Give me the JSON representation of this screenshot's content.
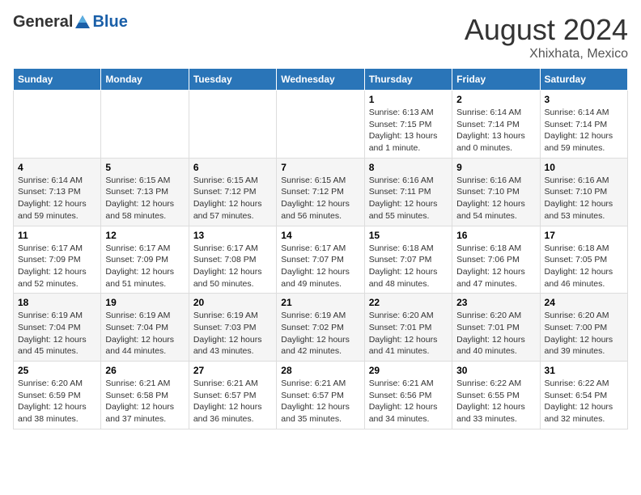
{
  "header": {
    "logo_general": "General",
    "logo_blue": "Blue",
    "month_year": "August 2024",
    "location": "Xhixhata, Mexico"
  },
  "days_of_week": [
    "Sunday",
    "Monday",
    "Tuesday",
    "Wednesday",
    "Thursday",
    "Friday",
    "Saturday"
  ],
  "weeks": [
    [
      {
        "day": "",
        "sunrise": "",
        "sunset": "",
        "daylight": ""
      },
      {
        "day": "",
        "sunrise": "",
        "sunset": "",
        "daylight": ""
      },
      {
        "day": "",
        "sunrise": "",
        "sunset": "",
        "daylight": ""
      },
      {
        "day": "",
        "sunrise": "",
        "sunset": "",
        "daylight": ""
      },
      {
        "day": "1",
        "sunrise": "Sunrise: 6:13 AM",
        "sunset": "Sunset: 7:15 PM",
        "daylight": "Daylight: 13 hours and 1 minute."
      },
      {
        "day": "2",
        "sunrise": "Sunrise: 6:14 AM",
        "sunset": "Sunset: 7:14 PM",
        "daylight": "Daylight: 13 hours and 0 minutes."
      },
      {
        "day": "3",
        "sunrise": "Sunrise: 6:14 AM",
        "sunset": "Sunset: 7:14 PM",
        "daylight": "Daylight: 12 hours and 59 minutes."
      }
    ],
    [
      {
        "day": "4",
        "sunrise": "Sunrise: 6:14 AM",
        "sunset": "Sunset: 7:13 PM",
        "daylight": "Daylight: 12 hours and 59 minutes."
      },
      {
        "day": "5",
        "sunrise": "Sunrise: 6:15 AM",
        "sunset": "Sunset: 7:13 PM",
        "daylight": "Daylight: 12 hours and 58 minutes."
      },
      {
        "day": "6",
        "sunrise": "Sunrise: 6:15 AM",
        "sunset": "Sunset: 7:12 PM",
        "daylight": "Daylight: 12 hours and 57 minutes."
      },
      {
        "day": "7",
        "sunrise": "Sunrise: 6:15 AM",
        "sunset": "Sunset: 7:12 PM",
        "daylight": "Daylight: 12 hours and 56 minutes."
      },
      {
        "day": "8",
        "sunrise": "Sunrise: 6:16 AM",
        "sunset": "Sunset: 7:11 PM",
        "daylight": "Daylight: 12 hours and 55 minutes."
      },
      {
        "day": "9",
        "sunrise": "Sunrise: 6:16 AM",
        "sunset": "Sunset: 7:10 PM",
        "daylight": "Daylight: 12 hours and 54 minutes."
      },
      {
        "day": "10",
        "sunrise": "Sunrise: 6:16 AM",
        "sunset": "Sunset: 7:10 PM",
        "daylight": "Daylight: 12 hours and 53 minutes."
      }
    ],
    [
      {
        "day": "11",
        "sunrise": "Sunrise: 6:17 AM",
        "sunset": "Sunset: 7:09 PM",
        "daylight": "Daylight: 12 hours and 52 minutes."
      },
      {
        "day": "12",
        "sunrise": "Sunrise: 6:17 AM",
        "sunset": "Sunset: 7:09 PM",
        "daylight": "Daylight: 12 hours and 51 minutes."
      },
      {
        "day": "13",
        "sunrise": "Sunrise: 6:17 AM",
        "sunset": "Sunset: 7:08 PM",
        "daylight": "Daylight: 12 hours and 50 minutes."
      },
      {
        "day": "14",
        "sunrise": "Sunrise: 6:17 AM",
        "sunset": "Sunset: 7:07 PM",
        "daylight": "Daylight: 12 hours and 49 minutes."
      },
      {
        "day": "15",
        "sunrise": "Sunrise: 6:18 AM",
        "sunset": "Sunset: 7:07 PM",
        "daylight": "Daylight: 12 hours and 48 minutes."
      },
      {
        "day": "16",
        "sunrise": "Sunrise: 6:18 AM",
        "sunset": "Sunset: 7:06 PM",
        "daylight": "Daylight: 12 hours and 47 minutes."
      },
      {
        "day": "17",
        "sunrise": "Sunrise: 6:18 AM",
        "sunset": "Sunset: 7:05 PM",
        "daylight": "Daylight: 12 hours and 46 minutes."
      }
    ],
    [
      {
        "day": "18",
        "sunrise": "Sunrise: 6:19 AM",
        "sunset": "Sunset: 7:04 PM",
        "daylight": "Daylight: 12 hours and 45 minutes."
      },
      {
        "day": "19",
        "sunrise": "Sunrise: 6:19 AM",
        "sunset": "Sunset: 7:04 PM",
        "daylight": "Daylight: 12 hours and 44 minutes."
      },
      {
        "day": "20",
        "sunrise": "Sunrise: 6:19 AM",
        "sunset": "Sunset: 7:03 PM",
        "daylight": "Daylight: 12 hours and 43 minutes."
      },
      {
        "day": "21",
        "sunrise": "Sunrise: 6:19 AM",
        "sunset": "Sunset: 7:02 PM",
        "daylight": "Daylight: 12 hours and 42 minutes."
      },
      {
        "day": "22",
        "sunrise": "Sunrise: 6:20 AM",
        "sunset": "Sunset: 7:01 PM",
        "daylight": "Daylight: 12 hours and 41 minutes."
      },
      {
        "day": "23",
        "sunrise": "Sunrise: 6:20 AM",
        "sunset": "Sunset: 7:01 PM",
        "daylight": "Daylight: 12 hours and 40 minutes."
      },
      {
        "day": "24",
        "sunrise": "Sunrise: 6:20 AM",
        "sunset": "Sunset: 7:00 PM",
        "daylight": "Daylight: 12 hours and 39 minutes."
      }
    ],
    [
      {
        "day": "25",
        "sunrise": "Sunrise: 6:20 AM",
        "sunset": "Sunset: 6:59 PM",
        "daylight": "Daylight: 12 hours and 38 minutes."
      },
      {
        "day": "26",
        "sunrise": "Sunrise: 6:21 AM",
        "sunset": "Sunset: 6:58 PM",
        "daylight": "Daylight: 12 hours and 37 minutes."
      },
      {
        "day": "27",
        "sunrise": "Sunrise: 6:21 AM",
        "sunset": "Sunset: 6:57 PM",
        "daylight": "Daylight: 12 hours and 36 minutes."
      },
      {
        "day": "28",
        "sunrise": "Sunrise: 6:21 AM",
        "sunset": "Sunset: 6:57 PM",
        "daylight": "Daylight: 12 hours and 35 minutes."
      },
      {
        "day": "29",
        "sunrise": "Sunrise: 6:21 AM",
        "sunset": "Sunset: 6:56 PM",
        "daylight": "Daylight: 12 hours and 34 minutes."
      },
      {
        "day": "30",
        "sunrise": "Sunrise: 6:22 AM",
        "sunset": "Sunset: 6:55 PM",
        "daylight": "Daylight: 12 hours and 33 minutes."
      },
      {
        "day": "31",
        "sunrise": "Sunrise: 6:22 AM",
        "sunset": "Sunset: 6:54 PM",
        "daylight": "Daylight: 12 hours and 32 minutes."
      }
    ]
  ]
}
